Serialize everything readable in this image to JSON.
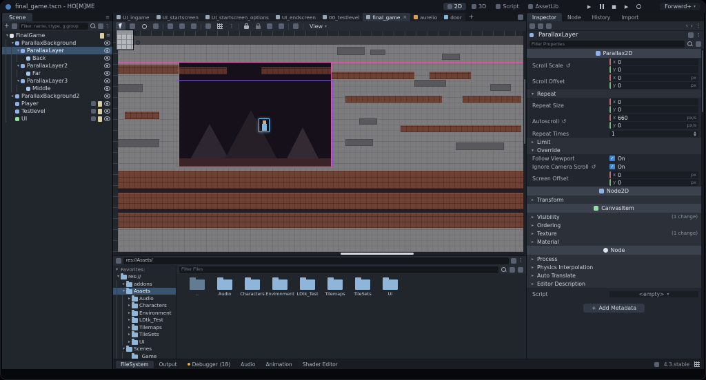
{
  "icons": {
    "expand_open": "▾",
    "expand_closed": "▸",
    "dropdown": "▾",
    "menu": "⋮",
    "menu_lines": "≡",
    "plus": "+",
    "close": "×",
    "back": "‹",
    "forward": "›",
    "revert": "↺",
    "check": "✓",
    "play": "▶",
    "stop": "■"
  },
  "window": {
    "title": "final_game.tscn - HO[M]ME",
    "renderer": "Forward+",
    "version": "4.3.stable"
  },
  "workspaces": [
    {
      "label": "2D"
    },
    {
      "label": "3D"
    },
    {
      "label": "Script"
    },
    {
      "label": "AssetLib"
    }
  ],
  "scene_dock": {
    "tab_label": "Scene",
    "filter_placeholder": "Filter: name, t:type, g:group",
    "nodes": [
      {
        "label": "FinalGame"
      },
      {
        "label": "ParallaxBackground"
      },
      {
        "label": "ParallaxLayer"
      },
      {
        "label": "Back"
      },
      {
        "label": "ParallaxLayer2"
      },
      {
        "label": "Far"
      },
      {
        "label": "ParallaxLayer3"
      },
      {
        "label": "Middle"
      },
      {
        "label": "ParallaxBackground2"
      },
      {
        "label": "Player"
      },
      {
        "label": "Testlevel"
      },
      {
        "label": "UI"
      }
    ]
  },
  "scene_tabs": [
    {
      "label": "UI_ingame"
    },
    {
      "label": "UI_startscreen"
    },
    {
      "label": "UI_startscreen_options"
    },
    {
      "label": "UI_endscreen"
    },
    {
      "label": "00_testlevel"
    },
    {
      "label": "final_game"
    },
    {
      "label": "aurelio"
    },
    {
      "label": "door"
    }
  ],
  "canvas_toolbar": {
    "view_menu": "View"
  },
  "filesystem": {
    "path": "res://Assets/",
    "favorites_label": "Favorites:",
    "tree": [
      {
        "label": "res://"
      },
      {
        "label": "addons"
      },
      {
        "label": "Assets"
      },
      {
        "label": "Audio"
      },
      {
        "label": "Characters"
      },
      {
        "label": "Environment"
      },
      {
        "label": "LDtk_Test"
      },
      {
        "label": "Tilemaps"
      },
      {
        "label": "TileSets"
      },
      {
        "label": "UI"
      },
      {
        "label": "Scenes"
      },
      {
        "label": "_Game"
      }
    ],
    "filter_placeholder": "Filter Files",
    "files": [
      {
        "label": ".."
      },
      {
        "label": "Audio"
      },
      {
        "label": "Characters"
      },
      {
        "label": "Environment"
      },
      {
        "label": "LDtk_Test"
      },
      {
        "label": "Tilemaps"
      },
      {
        "label": "TileSets"
      },
      {
        "label": "UI"
      }
    ]
  },
  "inspector": {
    "tabs": [
      {
        "label": "Inspector"
      },
      {
        "label": "Node"
      },
      {
        "label": "History"
      },
      {
        "label": "Import"
      }
    ],
    "node_name": "ParallaxLayer",
    "filter_placeholder": "Filter Properties",
    "axis_x": "x",
    "axis_y": "y",
    "category_parallax": "Parallax2D",
    "props": {
      "scroll_scale": {
        "label": "Scroll Scale",
        "x": "0",
        "y": "0"
      },
      "scroll_offset": {
        "label": "Scroll Offset",
        "x": "0",
        "y": "0",
        "unit": "px"
      },
      "repeat_group": "Repeat",
      "repeat_size": {
        "label": "Repeat Size",
        "x": "0",
        "y": "0"
      },
      "autoscroll": {
        "label": "Autoscroll",
        "x": "660",
        "y": "0",
        "unit": "px/s"
      },
      "repeat_times": {
        "label": "Repeat Times",
        "value": "1"
      },
      "limit_group": "Limit",
      "override_group": "Override",
      "follow_viewport": {
        "label": "Follow Viewport",
        "value": "On"
      },
      "ignore_camera_scroll": {
        "label": "Ignore Camera Scroll",
        "value": "On"
      },
      "screen_offset": {
        "label": "Screen Offset",
        "x": "0",
        "y": "0",
        "unit": "px"
      }
    },
    "category_node2d": "Node2D",
    "section_transform": "Transform",
    "category_canvasitem": "CanvasItem",
    "canvasitem_sections": [
      {
        "label": "Visibility",
        "badge": "(1 change)"
      },
      {
        "label": "Ordering",
        "badge": ""
      },
      {
        "label": "Texture",
        "badge": "(1 change)"
      },
      {
        "label": "Material",
        "badge": ""
      }
    ],
    "category_node": "Node",
    "node_sections": [
      {
        "label": "Process"
      },
      {
        "label": "Physics Interpolation"
      },
      {
        "label": "Auto Translate"
      },
      {
        "label": "Editor Description"
      }
    ],
    "script_row": {
      "label": "Script",
      "value": "<empty>"
    },
    "add_metadata_label": "Add Metadata"
  },
  "bottom_bar": {
    "tabs": [
      {
        "label": "FileSystem"
      },
      {
        "label": "Output"
      },
      {
        "label": "Debugger",
        "badge": "(18)"
      },
      {
        "label": "Audio"
      },
      {
        "label": "Animation"
      },
      {
        "label": "Shader Editor"
      }
    ]
  },
  "colors": {
    "accent": "#4f8fd0",
    "selection": "#3a536f",
    "folder_icon": "#8fb6d8",
    "debugger_dot": "#dfae3c",
    "viewport_bg": "#7c7c7f",
    "terrain_brick": "#6e4135",
    "level_dark_area": "#151019",
    "selection_pink": "#d957a8",
    "selection_purple": "#7d5bc8"
  }
}
